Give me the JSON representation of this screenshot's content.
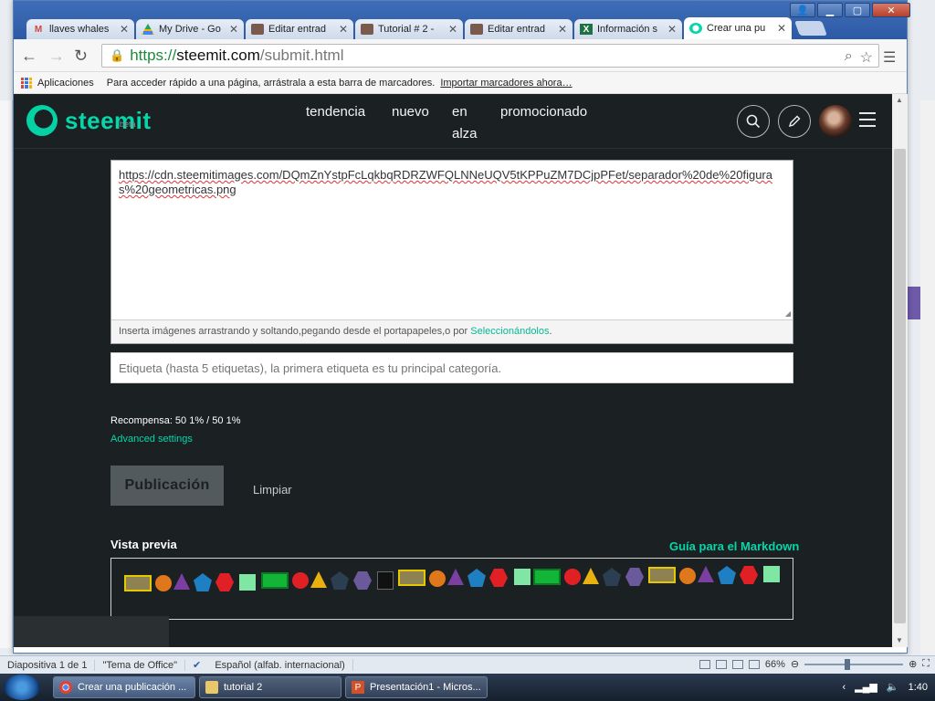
{
  "browser": {
    "tabs": [
      {
        "label": "llaves whales",
        "icon": "gmail-icon"
      },
      {
        "label": "My Drive - Go",
        "icon": "drive-icon"
      },
      {
        "label": "Editar entrad",
        "icon": "avatar-icon"
      },
      {
        "label": "Tutorial # 2 -",
        "icon": "avatar-icon"
      },
      {
        "label": "Editar entrad",
        "icon": "avatar-icon"
      },
      {
        "label": "Información s",
        "icon": "excel-icon"
      },
      {
        "label": "Crear una pu",
        "icon": "steemit-icon"
      }
    ],
    "url_scheme": "https://",
    "url_host": "steemit.com",
    "url_path": "/submit.html",
    "bookmarks": {
      "apps_label": "Aplicaciones",
      "hint": "Para acceder rápido a una página, arrástrala a esta barra de marcadores.",
      "import_link": "Importar marcadores ahora…"
    }
  },
  "steemit": {
    "logo_text": "steemit",
    "logo_beta": "beta",
    "nav": {
      "trending": "tendencia",
      "new": "nuevo",
      "hot_line1": "en",
      "hot_line2": "alza",
      "promoted": "promocionado"
    },
    "editor": {
      "content": "https://cdn.steemitimages.com/DQmZnYstpFcLqkbqRDRZWFQLNNeUQV5tKPPuZM7DCjpPFet/separador%20de%20figuras%20geometricas.png",
      "footer_text": "Inserta imágenes arrastrando y soltando,pegando desde el portapapeles,o por ",
      "footer_link": "Seleccionándolos",
      "footer_end": "."
    },
    "tags_placeholder": "Etiqueta (hasta 5 etiquetas), la primera etiqueta es tu principal categoría.",
    "reward": "Recompensa: 50 1% / 50 1%",
    "advanced_settings": "Advanced settings",
    "publish_button": "Publicación",
    "clear_button": "Limpiar",
    "preview_label": "Vista previa",
    "markdown_guide": "Guía para el Markdown"
  },
  "powerpoint_status": {
    "slide": "Diapositiva 1 de 1",
    "theme": "\"Tema de Office\"",
    "language": "Español (alfab. internacional)",
    "zoom": "66%"
  },
  "taskbar": {
    "tasks": [
      {
        "label": "Crear una publicación ...",
        "icon": "chrome-icon"
      },
      {
        "label": "tutorial 2",
        "icon": "folder-icon"
      },
      {
        "label": "Presentación1 - Micros...",
        "icon": "powerpoint-icon"
      }
    ],
    "clock": "1:40"
  },
  "colors": {
    "steemit_accent": "#06d6a9",
    "steemit_bg": "#1b2022"
  }
}
